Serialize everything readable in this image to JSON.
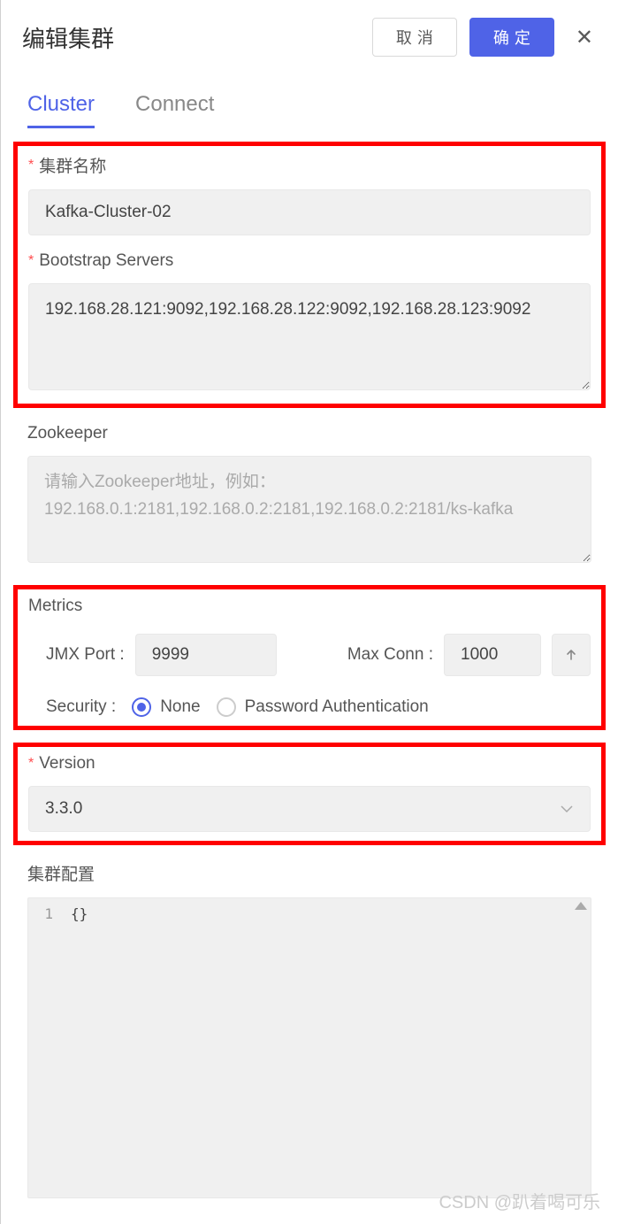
{
  "header": {
    "title": "编辑集群",
    "cancel_label": "取消",
    "confirm_label": "确定"
  },
  "tabs": {
    "cluster": "Cluster",
    "connect": "Connect"
  },
  "form": {
    "cluster_name": {
      "label": "集群名称",
      "value": "Kafka-Cluster-02"
    },
    "bootstrap": {
      "label": "Bootstrap Servers",
      "value": "192.168.28.121:9092,192.168.28.122:9092,192.168.28.123:9092"
    },
    "zookeeper": {
      "label": "Zookeeper",
      "placeholder": "请输入Zookeeper地址，例如：192.168.0.1:2181,192.168.0.2:2181,192.168.0.2:2181/ks-kafka",
      "value": ""
    },
    "metrics": {
      "label": "Metrics",
      "jmx_port_label": "JMX Port :",
      "jmx_port_value": "9999",
      "max_conn_label": "Max Conn :",
      "max_conn_value": "1000",
      "security_label": "Security :",
      "option_none": "None",
      "option_password": "Password Authentication"
    },
    "version": {
      "label": "Version",
      "value": "3.3.0"
    },
    "cluster_config": {
      "label": "集群配置",
      "line_no": "1",
      "content": "{}"
    }
  },
  "watermark": "CSDN @趴着喝可乐"
}
